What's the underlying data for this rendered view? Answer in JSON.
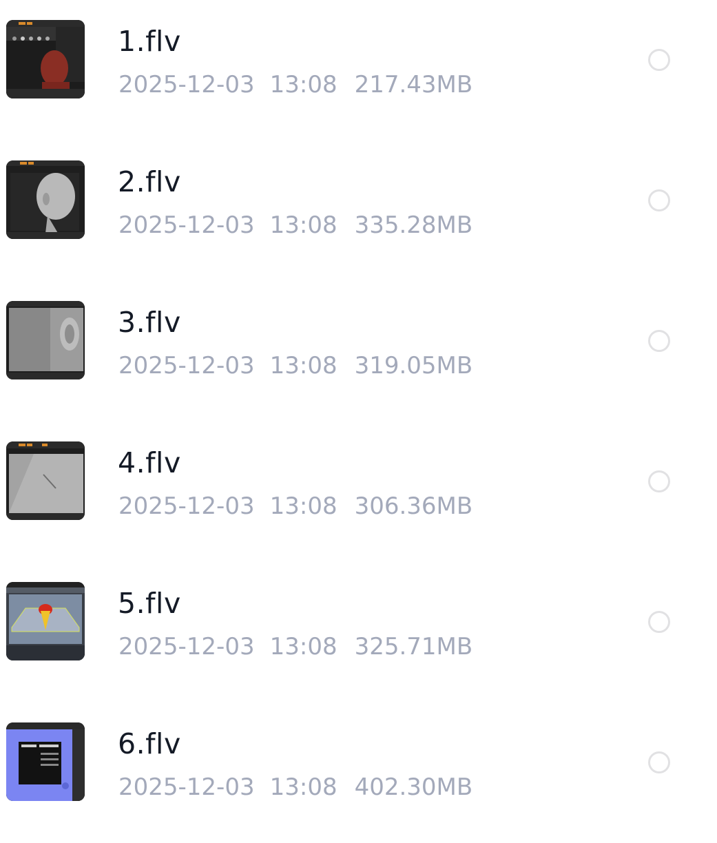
{
  "files": [
    {
      "name": "1.flv",
      "date": "2025-12-03",
      "time": "13:08",
      "size": "217.43MB",
      "thumbnail": "video-thumbnail-sculpt-head-red",
      "selected": false
    },
    {
      "name": "2.flv",
      "date": "2025-12-03",
      "time": "13:08",
      "size": "335.28MB",
      "thumbnail": "video-thumbnail-sculpt-head-grey",
      "selected": false
    },
    {
      "name": "3.flv",
      "date": "2025-12-03",
      "time": "13:08",
      "size": "319.05MB",
      "thumbnail": "video-thumbnail-sculpt-ear",
      "selected": false
    },
    {
      "name": "4.flv",
      "date": "2025-12-03",
      "time": "13:08",
      "size": "306.36MB",
      "thumbnail": "video-thumbnail-sculpt-skin-detail",
      "selected": false
    },
    {
      "name": "5.flv",
      "date": "2025-12-03",
      "time": "13:08",
      "size": "325.71MB",
      "thumbnail": "video-thumbnail-heatmap-mesh",
      "selected": false
    },
    {
      "name": "6.flv",
      "date": "2025-12-03",
      "time": "13:08",
      "size": "402.30MB",
      "thumbnail": "video-thumbnail-desktop-software",
      "selected": false
    }
  ],
  "colors": {
    "name_text": "#141a26",
    "meta_text": "#a3a9ba",
    "radio_border": "#e1e1e3",
    "background": "#ffffff"
  }
}
